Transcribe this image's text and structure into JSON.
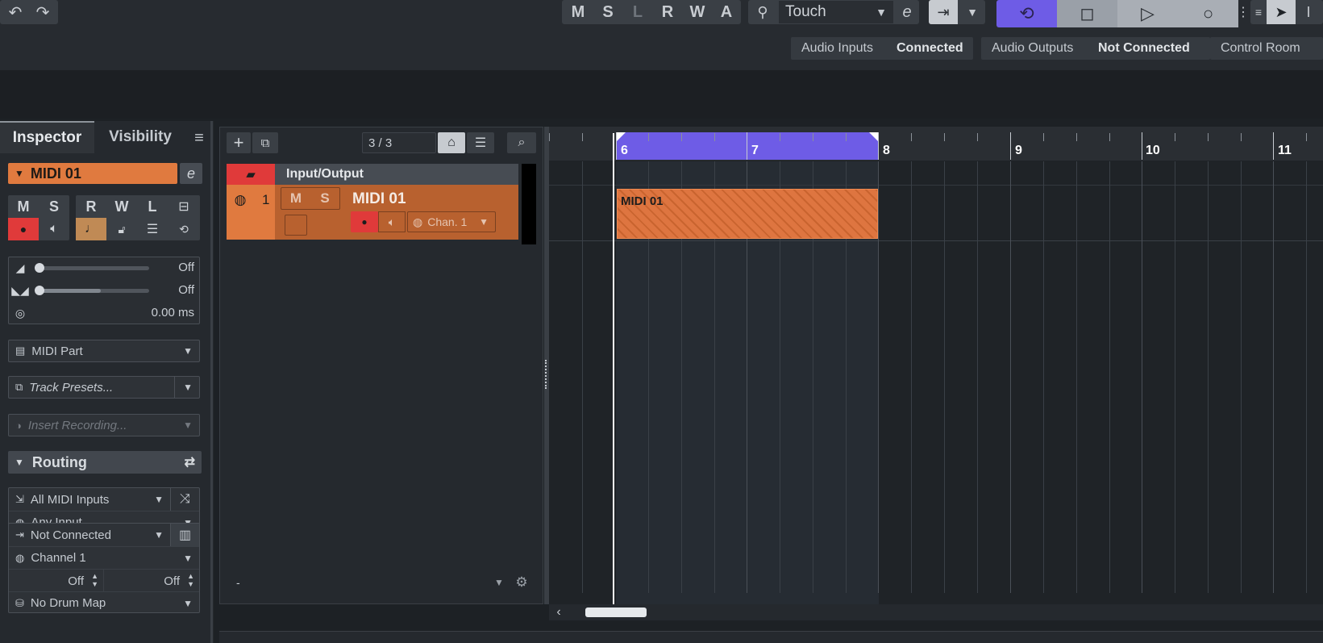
{
  "toolbar": {
    "mode_buttons": [
      "M",
      "S",
      "L",
      "R",
      "W",
      "A"
    ],
    "automation_mode": "Touch",
    "e_label": "e"
  },
  "status": {
    "audio_inputs_label": "Audio Inputs",
    "audio_inputs_value": "Connected",
    "audio_outputs_label": "Audio Outputs",
    "audio_outputs_value": "Not Connected",
    "control_room_label": "Control Room"
  },
  "inspector": {
    "tab_inspector": "Inspector",
    "tab_visibility": "Visibility",
    "track_name": "MIDI 01",
    "buttons": [
      "M",
      "S",
      "R",
      "W",
      "L"
    ],
    "volume_value": "Off",
    "pan_value": "Off",
    "delay_value": "0.00 ms",
    "part_type": "MIDI Part",
    "track_presets": "Track Presets...",
    "insert_recording": "Insert Recording...",
    "routing_label": "Routing",
    "midi_input": "All MIDI Inputs",
    "input_filter": "Any Input",
    "output": "Not Connected",
    "channel": "Channel 1",
    "left_off": "Off",
    "right_off": "Off",
    "drum_map": "No Drum Map"
  },
  "tracklist": {
    "count": "3 / 3",
    "folder_name": "Input/Output",
    "track_number": "1",
    "track_name": "MIDI 01",
    "mute": "M",
    "solo": "S",
    "channel": "Chan. 1",
    "footer_dash": "-"
  },
  "timeline": {
    "bars": [
      "6",
      "7",
      "8",
      "9",
      "10",
      "11"
    ],
    "part_name": "MIDI 01"
  },
  "colors": {
    "accent": "#6e5ce6",
    "track": "#d9743f",
    "record": "#e03a3a"
  }
}
